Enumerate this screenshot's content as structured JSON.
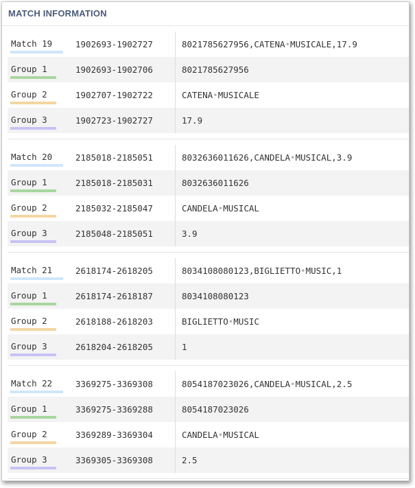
{
  "title": "MATCH INFORMATION",
  "colors": {
    "match": "#cfe6fb",
    "group1": "#a9d6a0",
    "group2": "#f4d6a2",
    "group3": "#c7c3f4"
  },
  "matches": [
    {
      "label": "Match 19",
      "range": "1902693-1902727",
      "value": [
        "8021785627956,CATENA",
        "MUSICALE,17.9"
      ],
      "groups": [
        {
          "label": "Group 1",
          "range": "1902693-1902706",
          "value": [
            "8021785627956"
          ]
        },
        {
          "label": "Group 2",
          "range": "1902707-1902722",
          "value": [
            "CATENA",
            "MUSICALE"
          ]
        },
        {
          "label": "Group 3",
          "range": "1902723-1902727",
          "value": [
            "17.9"
          ]
        }
      ]
    },
    {
      "label": "Match 20",
      "range": "2185018-2185051",
      "value": [
        "8032636011626,CANDELA",
        "MUSICAL,3.9"
      ],
      "groups": [
        {
          "label": "Group 1",
          "range": "2185018-2185031",
          "value": [
            "8032636011626"
          ]
        },
        {
          "label": "Group 2",
          "range": "2185032-2185047",
          "value": [
            "CANDELA",
            "MUSICAL"
          ]
        },
        {
          "label": "Group 3",
          "range": "2185048-2185051",
          "value": [
            "3.9"
          ]
        }
      ]
    },
    {
      "label": "Match 21",
      "range": "2618174-2618205",
      "value": [
        "8034108080123,BIGLIETTO",
        "MUSIC,1"
      ],
      "groups": [
        {
          "label": "Group 1",
          "range": "2618174-2618187",
          "value": [
            "8034108080123"
          ]
        },
        {
          "label": "Group 2",
          "range": "2618188-2618203",
          "value": [
            "BIGLIETTO",
            "MUSIC"
          ]
        },
        {
          "label": "Group 3",
          "range": "2618204-2618205",
          "value": [
            "1"
          ]
        }
      ]
    },
    {
      "label": "Match 22",
      "range": "3369275-3369308",
      "value": [
        "8054187023026,CANDELA",
        "MUSICAL,2.5"
      ],
      "groups": [
        {
          "label": "Group 1",
          "range": "3369275-3369288",
          "value": [
            "8054187023026"
          ]
        },
        {
          "label": "Group 2",
          "range": "3369289-3369304",
          "value": [
            "CANDELA",
            "MUSICAL"
          ]
        },
        {
          "label": "Group 3",
          "range": "3369305-3369308",
          "value": [
            "2.5"
          ]
        }
      ]
    }
  ]
}
